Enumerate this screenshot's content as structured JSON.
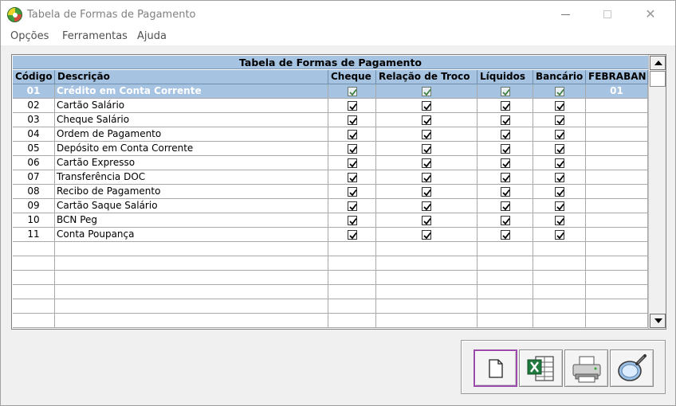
{
  "window": {
    "title": "Tabela de Formas de Pagamento",
    "app_icon": "app-logo-icon",
    "controls": [
      "minimize-icon",
      "maximize-icon",
      "close-icon"
    ],
    "close_glyph": "✕"
  },
  "menu": {
    "items": [
      {
        "label": "Opções"
      },
      {
        "label": "Ferramentas"
      },
      {
        "label": "Ajuda"
      }
    ]
  },
  "table": {
    "title": "Tabela de Formas de Pagamento",
    "columns": [
      "Código",
      "Descrição",
      "Cheque",
      "Relação de Troco",
      "Líquidos",
      "Bancário",
      "FEBRABAN"
    ],
    "selected_row": 0,
    "rows": [
      {
        "codigo": "01",
        "descricao": "Crédito em Conta Corrente",
        "cheque": true,
        "troco": true,
        "liquidos": true,
        "bancario": true,
        "febraban": "01"
      },
      {
        "codigo": "02",
        "descricao": "Cartão Salário",
        "cheque": true,
        "troco": true,
        "liquidos": true,
        "bancario": true,
        "febraban": ""
      },
      {
        "codigo": "03",
        "descricao": "Cheque Salário",
        "cheque": true,
        "troco": true,
        "liquidos": true,
        "bancario": true,
        "febraban": ""
      },
      {
        "codigo": "04",
        "descricao": "Ordem de Pagamento",
        "cheque": true,
        "troco": true,
        "liquidos": true,
        "bancario": true,
        "febraban": ""
      },
      {
        "codigo": "05",
        "descricao": "Depósito em Conta Corrente",
        "cheque": true,
        "troco": true,
        "liquidos": true,
        "bancario": true,
        "febraban": ""
      },
      {
        "codigo": "06",
        "descricao": "Cartão Expresso",
        "cheque": true,
        "troco": true,
        "liquidos": true,
        "bancario": true,
        "febraban": ""
      },
      {
        "codigo": "07",
        "descricao": "Transferência DOC",
        "cheque": true,
        "troco": true,
        "liquidos": true,
        "bancario": true,
        "febraban": ""
      },
      {
        "codigo": "08",
        "descricao": "Recibo de Pagamento",
        "cheque": true,
        "troco": true,
        "liquidos": true,
        "bancario": true,
        "febraban": ""
      },
      {
        "codigo": "09",
        "descricao": "Cartão Saque Salário",
        "cheque": true,
        "troco": true,
        "liquidos": true,
        "bancario": true,
        "febraban": ""
      },
      {
        "codigo": "10",
        "descricao": "BCN Peg",
        "cheque": true,
        "troco": true,
        "liquidos": true,
        "bancario": true,
        "febraban": ""
      },
      {
        "codigo": "11",
        "descricao": "Conta Poupança",
        "cheque": true,
        "troco": true,
        "liquidos": true,
        "bancario": true,
        "febraban": ""
      }
    ],
    "colors": {
      "header": "#a6c4e2",
      "selected_row": "#a6c4e2",
      "grid_line": "#a9a9a9"
    }
  },
  "toolbar": {
    "buttons": [
      {
        "name": "new-document-button",
        "icon": "blank-document-icon",
        "active": true
      },
      {
        "name": "export-excel-button",
        "icon": "excel-export-icon",
        "active": false
      },
      {
        "name": "print-button",
        "icon": "printer-icon",
        "active": false
      },
      {
        "name": "preview-button",
        "icon": "magnifier-icon",
        "active": false
      }
    ],
    "active_border_color": "#9a4aa8"
  }
}
